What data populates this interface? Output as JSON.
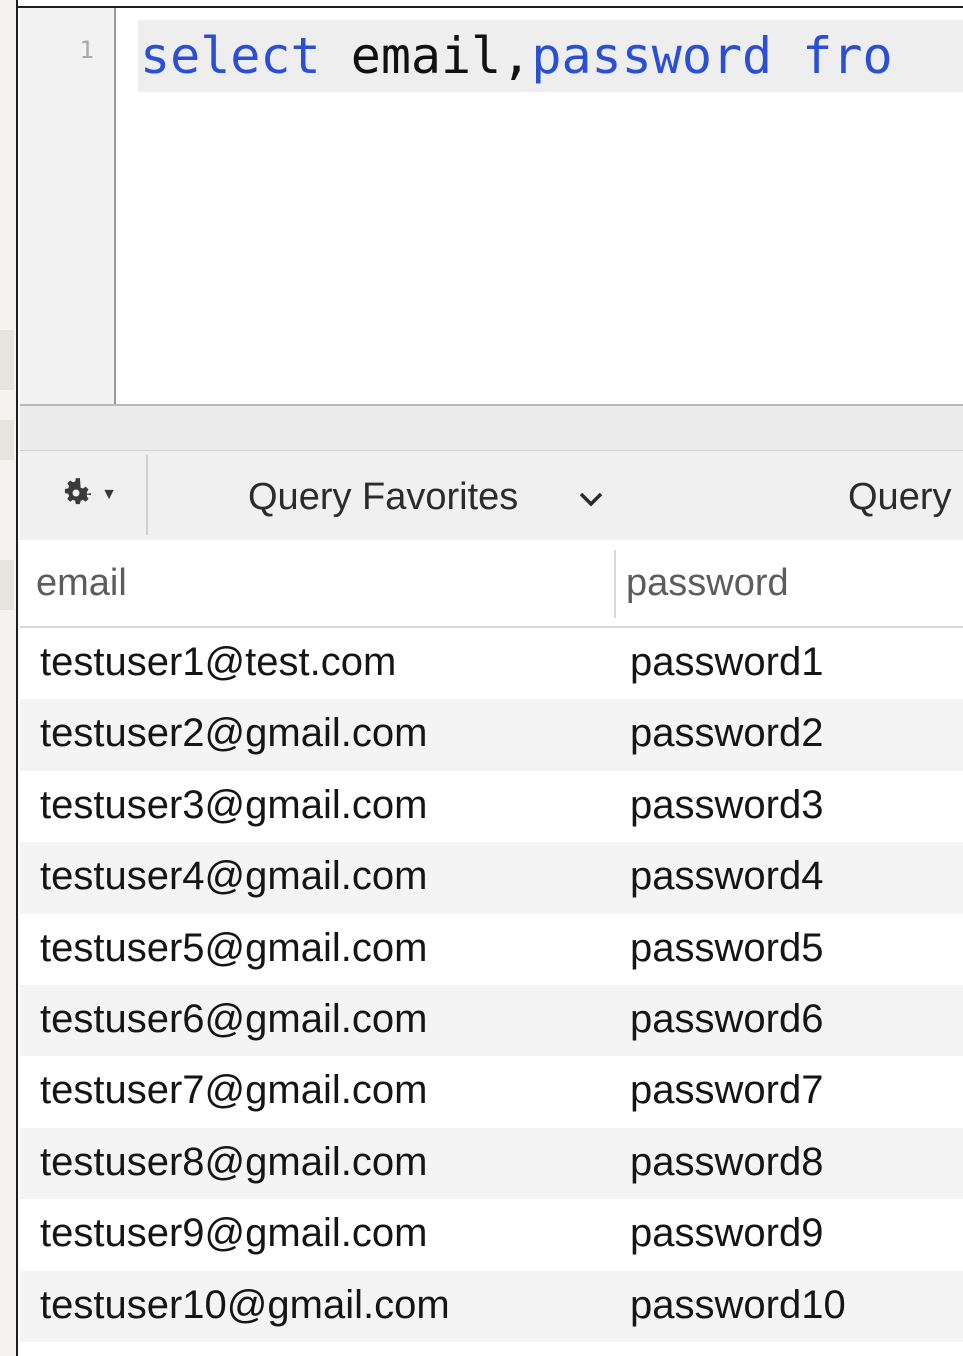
{
  "editor": {
    "line_number": "1",
    "code": {
      "kw1": "select",
      "ident": " email,",
      "kw2": "password",
      "rest": " fro"
    }
  },
  "toolbar": {
    "gear_icon": "gear-icon",
    "query_favorites_label": "Query Favorites",
    "query_label": "Query"
  },
  "results": {
    "columns": [
      "email",
      "password"
    ],
    "rows": [
      [
        "testuser1@test.com",
        "password1"
      ],
      [
        "testuser2@gmail.com",
        "password2"
      ],
      [
        "testuser3@gmail.com",
        "password3"
      ],
      [
        "testuser4@gmail.com",
        "password4"
      ],
      [
        "testuser5@gmail.com",
        "password5"
      ],
      [
        "testuser6@gmail.com",
        "password6"
      ],
      [
        "testuser7@gmail.com",
        "password7"
      ],
      [
        "testuser8@gmail.com",
        "password8"
      ],
      [
        "testuser9@gmail.com",
        "password9"
      ],
      [
        "testuser10@gmail.com",
        "password10"
      ]
    ]
  },
  "colors": {
    "keyword": "#2a4fd6",
    "identifier": "#111111",
    "gutter": "#f2f2f2",
    "row_alt": "#f4f4f4"
  }
}
